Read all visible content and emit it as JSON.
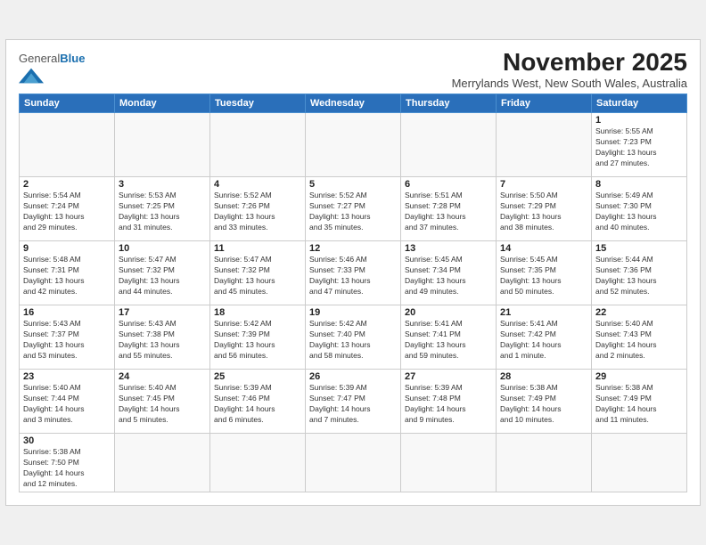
{
  "header": {
    "logo_general": "General",
    "logo_blue": "Blue",
    "month_title": "November 2025",
    "location": "Merrylands West, New South Wales, Australia"
  },
  "weekdays": [
    "Sunday",
    "Monday",
    "Tuesday",
    "Wednesday",
    "Thursday",
    "Friday",
    "Saturday"
  ],
  "weeks": [
    [
      {
        "day": "",
        "info": ""
      },
      {
        "day": "",
        "info": ""
      },
      {
        "day": "",
        "info": ""
      },
      {
        "day": "",
        "info": ""
      },
      {
        "day": "",
        "info": ""
      },
      {
        "day": "",
        "info": ""
      },
      {
        "day": "1",
        "info": "Sunrise: 5:55 AM\nSunset: 7:23 PM\nDaylight: 13 hours\nand 27 minutes."
      }
    ],
    [
      {
        "day": "2",
        "info": "Sunrise: 5:54 AM\nSunset: 7:24 PM\nDaylight: 13 hours\nand 29 minutes."
      },
      {
        "day": "3",
        "info": "Sunrise: 5:53 AM\nSunset: 7:25 PM\nDaylight: 13 hours\nand 31 minutes."
      },
      {
        "day": "4",
        "info": "Sunrise: 5:52 AM\nSunset: 7:26 PM\nDaylight: 13 hours\nand 33 minutes."
      },
      {
        "day": "5",
        "info": "Sunrise: 5:52 AM\nSunset: 7:27 PM\nDaylight: 13 hours\nand 35 minutes."
      },
      {
        "day": "6",
        "info": "Sunrise: 5:51 AM\nSunset: 7:28 PM\nDaylight: 13 hours\nand 37 minutes."
      },
      {
        "day": "7",
        "info": "Sunrise: 5:50 AM\nSunset: 7:29 PM\nDaylight: 13 hours\nand 38 minutes."
      },
      {
        "day": "8",
        "info": "Sunrise: 5:49 AM\nSunset: 7:30 PM\nDaylight: 13 hours\nand 40 minutes."
      }
    ],
    [
      {
        "day": "9",
        "info": "Sunrise: 5:48 AM\nSunset: 7:31 PM\nDaylight: 13 hours\nand 42 minutes."
      },
      {
        "day": "10",
        "info": "Sunrise: 5:47 AM\nSunset: 7:32 PM\nDaylight: 13 hours\nand 44 minutes."
      },
      {
        "day": "11",
        "info": "Sunrise: 5:47 AM\nSunset: 7:32 PM\nDaylight: 13 hours\nand 45 minutes."
      },
      {
        "day": "12",
        "info": "Sunrise: 5:46 AM\nSunset: 7:33 PM\nDaylight: 13 hours\nand 47 minutes."
      },
      {
        "day": "13",
        "info": "Sunrise: 5:45 AM\nSunset: 7:34 PM\nDaylight: 13 hours\nand 49 minutes."
      },
      {
        "day": "14",
        "info": "Sunrise: 5:45 AM\nSunset: 7:35 PM\nDaylight: 13 hours\nand 50 minutes."
      },
      {
        "day": "15",
        "info": "Sunrise: 5:44 AM\nSunset: 7:36 PM\nDaylight: 13 hours\nand 52 minutes."
      }
    ],
    [
      {
        "day": "16",
        "info": "Sunrise: 5:43 AM\nSunset: 7:37 PM\nDaylight: 13 hours\nand 53 minutes."
      },
      {
        "day": "17",
        "info": "Sunrise: 5:43 AM\nSunset: 7:38 PM\nDaylight: 13 hours\nand 55 minutes."
      },
      {
        "day": "18",
        "info": "Sunrise: 5:42 AM\nSunset: 7:39 PM\nDaylight: 13 hours\nand 56 minutes."
      },
      {
        "day": "19",
        "info": "Sunrise: 5:42 AM\nSunset: 7:40 PM\nDaylight: 13 hours\nand 58 minutes."
      },
      {
        "day": "20",
        "info": "Sunrise: 5:41 AM\nSunset: 7:41 PM\nDaylight: 13 hours\nand 59 minutes."
      },
      {
        "day": "21",
        "info": "Sunrise: 5:41 AM\nSunset: 7:42 PM\nDaylight: 14 hours\nand 1 minute."
      },
      {
        "day": "22",
        "info": "Sunrise: 5:40 AM\nSunset: 7:43 PM\nDaylight: 14 hours\nand 2 minutes."
      }
    ],
    [
      {
        "day": "23",
        "info": "Sunrise: 5:40 AM\nSunset: 7:44 PM\nDaylight: 14 hours\nand 3 minutes."
      },
      {
        "day": "24",
        "info": "Sunrise: 5:40 AM\nSunset: 7:45 PM\nDaylight: 14 hours\nand 5 minutes."
      },
      {
        "day": "25",
        "info": "Sunrise: 5:39 AM\nSunset: 7:46 PM\nDaylight: 14 hours\nand 6 minutes."
      },
      {
        "day": "26",
        "info": "Sunrise: 5:39 AM\nSunset: 7:47 PM\nDaylight: 14 hours\nand 7 minutes."
      },
      {
        "day": "27",
        "info": "Sunrise: 5:39 AM\nSunset: 7:48 PM\nDaylight: 14 hours\nand 9 minutes."
      },
      {
        "day": "28",
        "info": "Sunrise: 5:38 AM\nSunset: 7:49 PM\nDaylight: 14 hours\nand 10 minutes."
      },
      {
        "day": "29",
        "info": "Sunrise: 5:38 AM\nSunset: 7:49 PM\nDaylight: 14 hours\nand 11 minutes."
      }
    ],
    [
      {
        "day": "30",
        "info": "Sunrise: 5:38 AM\nSunset: 7:50 PM\nDaylight: 14 hours\nand 12 minutes."
      },
      {
        "day": "",
        "info": ""
      },
      {
        "day": "",
        "info": ""
      },
      {
        "day": "",
        "info": ""
      },
      {
        "day": "",
        "info": ""
      },
      {
        "day": "",
        "info": ""
      },
      {
        "day": "",
        "info": ""
      }
    ]
  ]
}
